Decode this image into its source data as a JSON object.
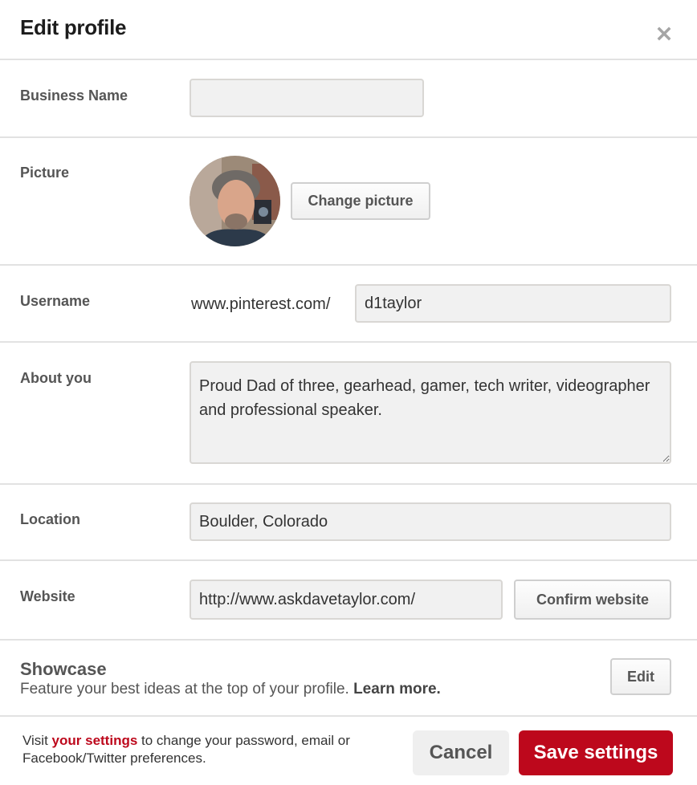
{
  "header": {
    "title": "Edit profile",
    "close_icon": "close-icon"
  },
  "business_name": {
    "label": "Business Name",
    "value": "",
    "placeholder": ""
  },
  "picture": {
    "label": "Picture",
    "change_button": "Change picture",
    "avatar": "profile-photo"
  },
  "username": {
    "label": "Username",
    "prefix": "www.pinterest.com/",
    "value": "d1taylor"
  },
  "about": {
    "label": "About you",
    "value": "Proud Dad of three, gearhead, gamer, tech writer, videographer and professional speaker."
  },
  "location": {
    "label": "Location",
    "value": "Boulder, Colorado"
  },
  "website": {
    "label": "Website",
    "value": "http://www.askdavetaylor.com/",
    "confirm_button": "Confirm website"
  },
  "showcase": {
    "title": "Showcase",
    "description": "Feature your best ideas at the top of your profile.",
    "learn_more": "Learn more.",
    "edit_button": "Edit"
  },
  "footer": {
    "note_prefix": "Visit",
    "settings_link": "your settings",
    "note_suffix": "to change your password, email or Facebook/Twitter preferences.",
    "cancel_button": "Cancel",
    "save_button": "Save settings"
  },
  "colors": {
    "accent": "#bd081c",
    "field_bg": "#f1f1f1",
    "divider": "#e2e2e2"
  }
}
